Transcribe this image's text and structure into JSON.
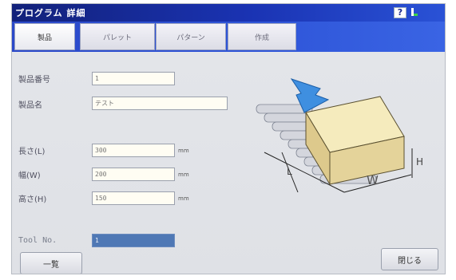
{
  "title": "プログラム 詳細",
  "help_glyph": "?",
  "tabs": [
    {
      "label": "製品",
      "active": true
    },
    {
      "label": "パレット",
      "active": false
    },
    {
      "label": "パターン",
      "active": false
    },
    {
      "label": "作成",
      "active": false
    }
  ],
  "fields": {
    "product_no": {
      "label": "製品番号",
      "value": "1"
    },
    "product_name": {
      "label": "製品名",
      "value": "テスト"
    },
    "length": {
      "label": "長さ(L)",
      "value": "300",
      "unit": "mm"
    },
    "width": {
      "label": "幅(W)",
      "value": "200",
      "unit": "mm"
    },
    "height": {
      "label": "高さ(H)",
      "value": "150",
      "unit": "mm"
    },
    "tool_no": {
      "label": "Tool No.",
      "value": "1"
    }
  },
  "buttons": {
    "list": "一覧",
    "close": "閉じる"
  },
  "diagram": {
    "w_label": "W",
    "l_label": "L",
    "h_label": "H"
  },
  "colors": {
    "title_bar": "#1a2fa8",
    "tab_bar": "#2f56d9",
    "selected_field": "#4f78b5",
    "box": "#efe3b0",
    "arrow": "#3f8fe0"
  }
}
